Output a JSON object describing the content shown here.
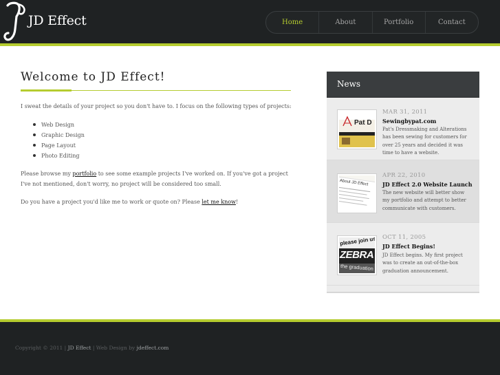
{
  "site": {
    "logo_text": "JD Effect"
  },
  "nav": {
    "items": [
      {
        "label": "Home",
        "active": true
      },
      {
        "label": "About",
        "active": false
      },
      {
        "label": "Portfolio",
        "active": false
      },
      {
        "label": "Contact",
        "active": false
      }
    ]
  },
  "main": {
    "title": "Welcome to JD Effect!",
    "intro": "I sweat the details of your project so you don't have to. I focus on the following types of projects:",
    "project_types": [
      "Web Design",
      "Graphic Design",
      "Page Layout",
      "Photo Editing"
    ],
    "browse_pre": "Please browse my ",
    "browse_link": "portfolio",
    "browse_post": " to see some example projects I've worked on. If you've got a project I've not mentioned, don't worry, no project will be considered too small.",
    "contact_pre": "Do you have a project you'd like me to work or quote on? Please ",
    "contact_link": "let me know",
    "contact_post": "!"
  },
  "news": {
    "heading": "News",
    "items": [
      {
        "date": "MAR 31, 2011",
        "title": "Sewingbypat.com",
        "description": "Pat's Dressmaking and Alterations has been sewing for customers for over 25 years and decided it was time to have a website.",
        "thumb_text": "Pat D"
      },
      {
        "date": "APR 22, 2010",
        "title": "JD Effect 2.0 Website Launch",
        "description": "The new website will better show my portfolio and attempt to better communicate with customers.",
        "thumb_text": "About JD Effect"
      },
      {
        "date": "OCT 11, 2005",
        "title": "JD Effect Begins!",
        "description": "JD Effect begins. My first project was to create an out-of-the-box graduation announcement.",
        "thumb_text_1": "please join us",
        "thumb_text_2": "ZEBRA",
        "thumb_text_3": "the graduation"
      }
    ]
  },
  "footer": {
    "copyright": "Copyright © 2011 |",
    "brand": "JD Effect",
    "web_design_by": "| Web Design by",
    "designer": "jdeffect.com"
  },
  "colors": {
    "accent": "#b5cc2f",
    "header_bg": "#1f2223",
    "news_head_bg": "#3a3d3f"
  }
}
